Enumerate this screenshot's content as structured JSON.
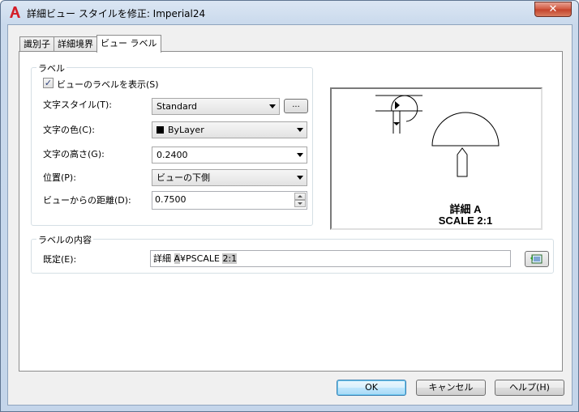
{
  "window": {
    "title": "詳細ビュー スタイルを修正: Imperial24",
    "close_label": "✕"
  },
  "tabs": [
    {
      "label": "識別子",
      "active": false
    },
    {
      "label": "詳細境界",
      "active": false
    },
    {
      "label": "ビュー ラベル",
      "active": true
    }
  ],
  "label_group": {
    "title": "ラベル",
    "show_label": {
      "label": "ビューのラベルを表示(S)",
      "checked": true
    },
    "text_style": {
      "label": "文字スタイル(T):",
      "value": "Standard",
      "browse_label": "..."
    },
    "text_color": {
      "label": "文字の色(C):",
      "value": "ByLayer",
      "swatch_color": "#000000"
    },
    "text_height": {
      "label": "文字の高さ(G):",
      "value": "0.2400"
    },
    "position": {
      "label": "位置(P):",
      "value": "ビューの下側"
    },
    "distance": {
      "label": "ビューからの距離(D):",
      "value": "0.7500"
    }
  },
  "preview": {
    "line1": "詳細 A",
    "line2": "SCALE 2:1"
  },
  "contents_group": {
    "title": "ラベルの内容",
    "default": {
      "label": "既定(E):",
      "value_prefix": "詳細 ",
      "value_field1": "A",
      "value_mid": "¥PSCALE ",
      "value_field2": "2:1"
    }
  },
  "buttons": {
    "ok": "OK",
    "cancel": "キャンセル",
    "help": "ヘルプ(H)"
  }
}
